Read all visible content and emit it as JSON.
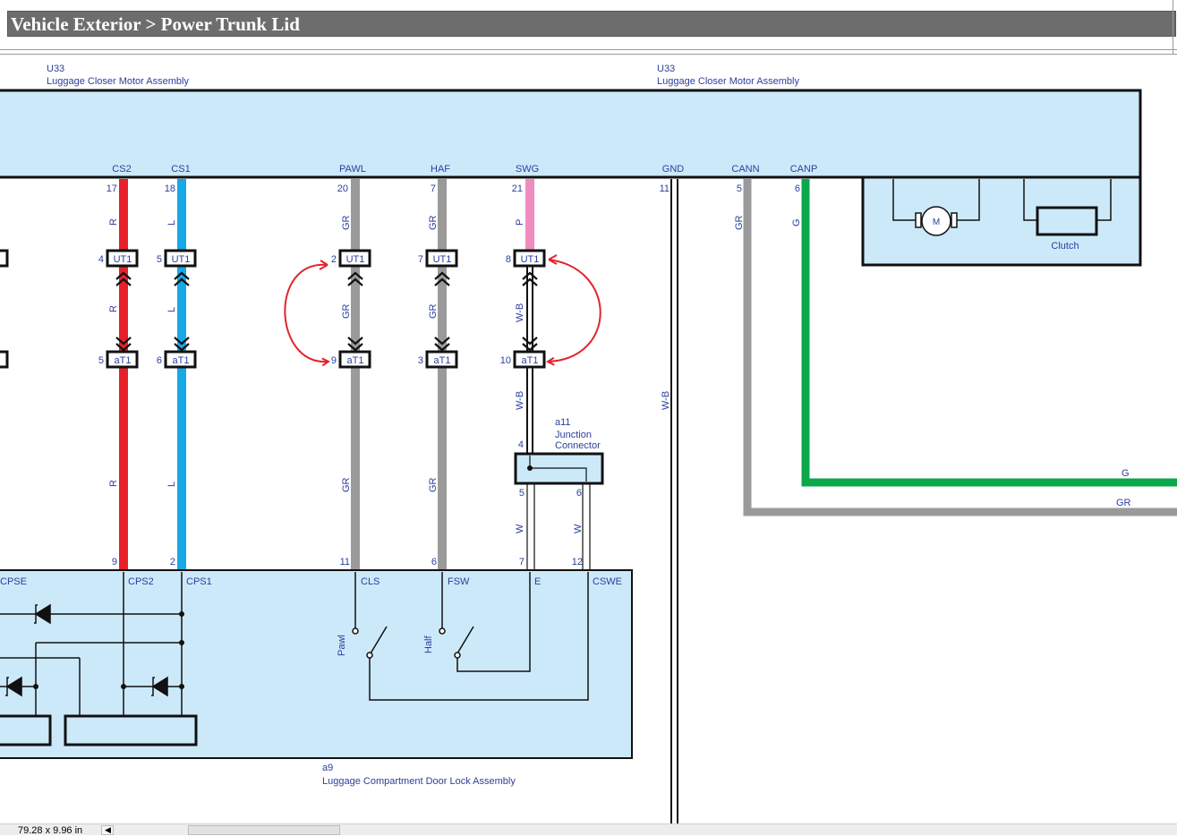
{
  "header": {
    "title": "Vehicle Exterior > Power Trunk Lid"
  },
  "status": {
    "zoom": "79.28 x 9.96 in"
  },
  "top_assembly_left": {
    "id": "U33",
    "name": "Luggage Closer Motor Assembly"
  },
  "top_assembly_right": {
    "id": "U33",
    "name": "Luggage Closer Motor Assembly"
  },
  "bottom_assembly": {
    "id": "a9",
    "name": "Luggage Compartment Door Lock Assembly"
  },
  "junction": {
    "id": "a11",
    "line1": "Junction",
    "line2": "Connector",
    "pin_in": "4",
    "pin_out_a": "5",
    "pin_out_b": "6"
  },
  "top_pins": {
    "cs2": "CS2",
    "cs1": "CS1",
    "pawl": "PAWL",
    "haf": "HAF",
    "swg": "SWG",
    "gnd": "GND",
    "cann": "CANN",
    "canp": "CANP"
  },
  "top_pin_numbers": {
    "cs2": "17",
    "cs1": "18",
    "pawl": "20",
    "haf": "7",
    "swg": "21",
    "gnd": "11",
    "cann": "5",
    "canp": "6"
  },
  "bottom_pins": {
    "cpse": "CPSE",
    "cps2": "CPS2",
    "cps1": "CPS1",
    "cls": "CLS",
    "fsw": "FSW",
    "e": "E",
    "cswe": "CSWE"
  },
  "bottom_pin_numbers": {
    "cs2": "9",
    "cs1": "2",
    "pawl": "11",
    "haf": "6",
    "e": "7",
    "cswe": "12"
  },
  "connectors": {
    "upper": "UT1",
    "lower": "aT1"
  },
  "upper_connector_pins": {
    "left_edge": "4",
    "cs2": "4",
    "cs1": "5",
    "pawl": "2",
    "haf": "7",
    "swg": "8"
  },
  "lower_connector_pins": {
    "cs2": "5",
    "cs1": "6",
    "pawl": "9",
    "haf": "3",
    "swg": "10"
  },
  "wire_colors": {
    "red": "R",
    "blue": "L",
    "gray": "GR",
    "pink": "P",
    "white_black": "W-B",
    "white": "W",
    "green": "G"
  },
  "component_labels": {
    "motor": "M",
    "clutch": "Clutch",
    "pawl_switch": "Pawl",
    "half_switch": "Half"
  },
  "palette": {
    "box_fill": "#cce9f9",
    "wire_red": "#e8202a",
    "wire_blue": "#17a8e6",
    "wire_gray": "#9a9a9a",
    "wire_pink": "#f08cbf",
    "wire_green": "#0aa84a",
    "label_blue": "#2b3f9c",
    "annotation_red": "#e0242b"
  }
}
